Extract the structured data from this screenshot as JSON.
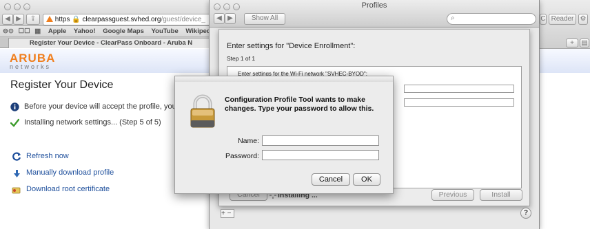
{
  "browser": {
    "url_https": "https",
    "url_domain": "clearpassguest.svhed.org",
    "url_path": "/guest/device_",
    "bookmarks": [
      "Apple",
      "Yahoo!",
      "Google Maps",
      "YouTube",
      "Wikipedia"
    ],
    "tab_title": "Register Your Device - ClearPass Onboard - Aruba N",
    "right_reader": "Reader",
    "right_plus": "+",
    "right_c": "C"
  },
  "page": {
    "logo_top": "ARUBA",
    "logo_bottom": "networks",
    "title": "Register Your Device",
    "info_text": "Before your device will accept the profile, you",
    "status_text": "Installing network settings... (Step 5 of 5)",
    "links": [
      "Refresh now",
      "Manually download profile",
      "Download root certificate"
    ]
  },
  "profiles": {
    "window_title": "Profiles",
    "show_all": "Show All",
    "sheet_heading": "Enter settings for \"Device Enrollment\":",
    "sheet_step": "Step 1 of 1",
    "wifi_text": "Enter settings for the Wi-Fi network \"SVHEC-BYOD\":",
    "cancel": "Cancel",
    "installing": "Installing ...",
    "previous": "Previous",
    "install": "Install",
    "help": "?",
    "plus_minus": "+ −"
  },
  "auth": {
    "message": "Configuration Profile Tool wants to make changes. Type your password to allow this.",
    "name_label": "Name:",
    "password_label": "Password:",
    "name_value": "",
    "password_value": "",
    "cancel": "Cancel",
    "ok": "OK"
  },
  "colors": {
    "link": "#1e4f9c",
    "aruba_orange": "#f07f1e",
    "status_check": "#3a9a2a"
  }
}
